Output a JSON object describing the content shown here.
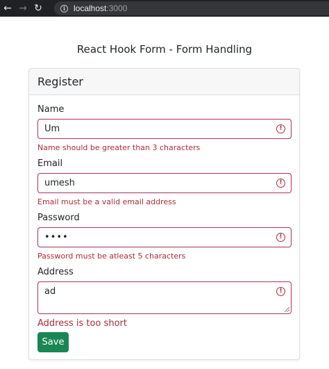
{
  "browser": {
    "back_icon": "←",
    "forward_icon": "→",
    "reload_icon": "↻",
    "url_host": "localhost",
    "url_port": ":3000"
  },
  "page": {
    "title": "React Hook Form - Form Handling"
  },
  "form": {
    "header": "Register",
    "fields": [
      {
        "label": "Name",
        "value": "Um",
        "error": "Name should be greater than 3 characters"
      },
      {
        "label": "Email",
        "value": "umesh",
        "error": "Email must be a valid email address"
      },
      {
        "label": "Password",
        "value": "••••",
        "error": "Password must be atleast 5 characters"
      },
      {
        "label": "Address",
        "value": "ad",
        "error": "Address is too short"
      }
    ],
    "save_label": "Save"
  },
  "colors": {
    "error": "#b02a37",
    "invalid_border": "#a8325e",
    "save_button": "#198754"
  }
}
